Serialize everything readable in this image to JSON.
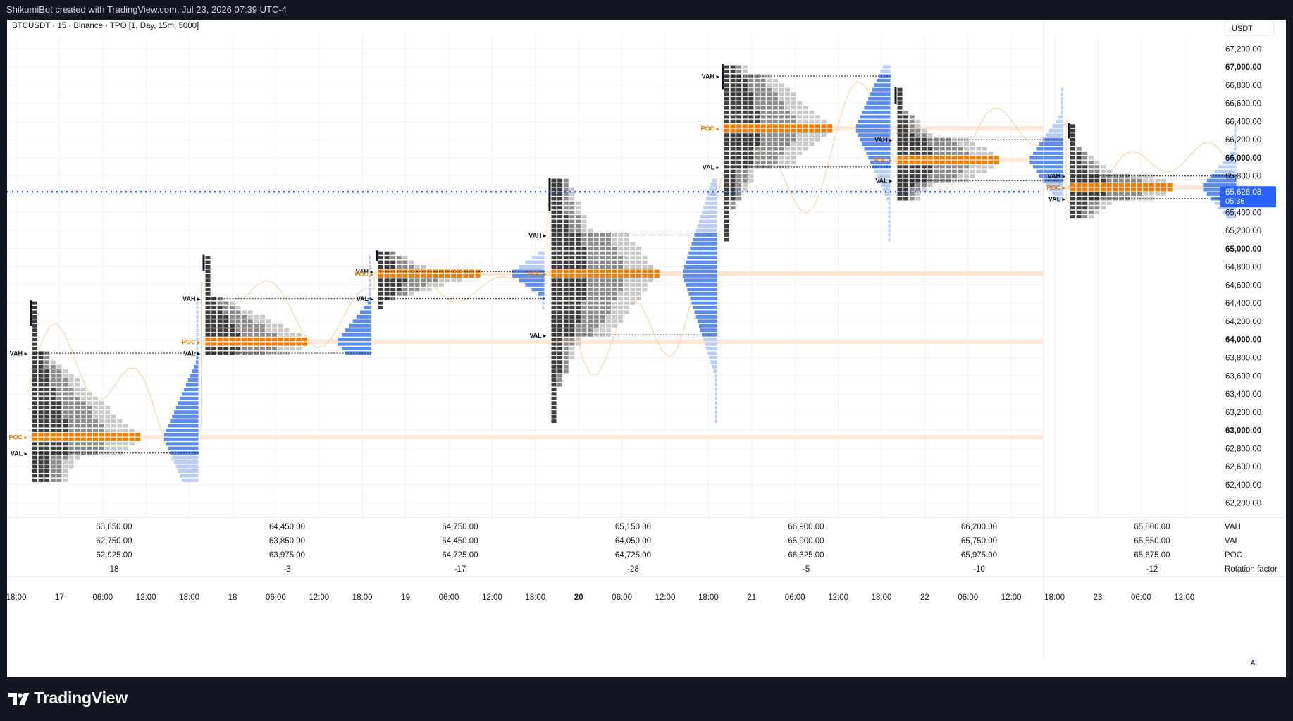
{
  "header": {
    "attribution": "ShikumiBot created with TradingView.com, Jul 23, 2026 07:39 UTC-4"
  },
  "legend": {
    "symbol_line": "BTCUSDT · 15 · Binance · TPO [1, Day, 15m, 5000]"
  },
  "currency_label": "USDT",
  "branding": {
    "logo_text": "TradingView",
    "auto_scale_label": "A"
  },
  "colors": {
    "poc": "#f57c00",
    "poc_band": "#fbe2cc",
    "profile_dark": "#3d3d3d",
    "profile_mid": "#8a8a8a",
    "profile_light": "#c8c8c8",
    "volume_blue": "#5b8def",
    "volume_blue_light": "#b8cdf7",
    "price_line": "#2962ff",
    "price_path": "#ffcc99",
    "grid": "#f0f3fa"
  },
  "chart_data": {
    "type": "tpo_profile",
    "symbol": "BTCUSDT",
    "exchange": "Binance",
    "interval": "15",
    "y_range": [
      62050,
      67350
    ],
    "y_ticks": [
      "67,200.00",
      "67,000.00",
      "66,800.00",
      "66,600.00",
      "66,400.00",
      "66,200.00",
      "66,000.00",
      "65,800.00",
      "65,600.00",
      "65,400.00",
      "65,200.00",
      "65,000.00",
      "64,800.00",
      "64,600.00",
      "64,400.00",
      "64,200.00",
      "64,000.00",
      "63,800.00",
      "63,600.00",
      "63,400.00",
      "63,200.00",
      "63,000.00",
      "62,800.00",
      "62,600.00",
      "62,400.00",
      "62,200.00"
    ],
    "y_ticks_bold": [
      "67,000.00",
      "66,000.00",
      "65,000.00",
      "64,000.00",
      "63,000.00"
    ],
    "x_ticks": [
      {
        "label": "18:00",
        "slot": 0
      },
      {
        "label": "17",
        "slot": 1
      },
      {
        "label": "06:00",
        "slot": 2
      },
      {
        "label": "12:00",
        "slot": 3
      },
      {
        "label": "18:00",
        "slot": 4
      },
      {
        "label": "18",
        "slot": 5
      },
      {
        "label": "06:00",
        "slot": 6
      },
      {
        "label": "12:00",
        "slot": 7
      },
      {
        "label": "18:00",
        "slot": 8
      },
      {
        "label": "19",
        "slot": 9
      },
      {
        "label": "06:00",
        "slot": 10
      },
      {
        "label": "12:00",
        "slot": 11
      },
      {
        "label": "18:00",
        "slot": 12
      },
      {
        "label": "20",
        "slot": 13,
        "bold": true
      },
      {
        "label": "06:00",
        "slot": 14
      },
      {
        "label": "12:00",
        "slot": 15
      },
      {
        "label": "18:00",
        "slot": 16
      },
      {
        "label": "21",
        "slot": 17
      },
      {
        "label": "06:00",
        "slot": 18
      },
      {
        "label": "12:00",
        "slot": 19
      },
      {
        "label": "18:00",
        "slot": 20
      },
      {
        "label": "22",
        "slot": 21
      },
      {
        "label": "06:00",
        "slot": 22
      },
      {
        "label": "12:00",
        "slot": 23
      },
      {
        "label": "18:00",
        "slot": 24
      },
      {
        "label": "23",
        "slot": 25
      },
      {
        "label": "06:00",
        "slot": 26
      },
      {
        "label": "12:00",
        "slot": 27
      }
    ],
    "last_price": {
      "value": 65626.08,
      "label": "65,626.08",
      "countdown": "05:36"
    },
    "sessions": [
      {
        "vah": 63850,
        "val": 62750,
        "poc": 62925,
        "vah_label": "63,850.00",
        "val_label": "62,750.00",
        "poc_label": "62,925.00",
        "rotation": "18",
        "high": 64400,
        "low": 62450
      },
      {
        "vah": 64450,
        "val": 63850,
        "poc": 63975,
        "vah_label": "64,450.00",
        "val_label": "63,850.00",
        "poc_label": "63,975.00",
        "rotation": "-3",
        "high": 64900,
        "low": 63850
      },
      {
        "vah": 64750,
        "val": 64450,
        "poc": 64725,
        "vah_label": "64,750.00",
        "val_label": "64,450.00",
        "poc_label": "64,725.00",
        "rotation": "-17",
        "high": 64950,
        "low": 64350
      },
      {
        "vah": 65150,
        "val": 64050,
        "poc": 64725,
        "vah_label": "65,150.00",
        "val_label": "64,050.00",
        "poc_label": "64,725.00",
        "rotation": "-28",
        "high": 65750,
        "low": 63100
      },
      {
        "vah": 66900,
        "val": 65900,
        "poc": 66325,
        "vah_label": "66,900.00",
        "val_label": "65,900.00",
        "poc_label": "66,325.00",
        "rotation": "-5",
        "high": 67000,
        "low": 65100
      },
      {
        "vah": 66200,
        "val": 65750,
        "poc": 65975,
        "vah_label": "66,200.00",
        "val_label": "65,750.00",
        "poc_label": "65,975.00",
        "rotation": "-10",
        "high": 66750,
        "low": 65550
      },
      {
        "vah": 65800,
        "val": 65550,
        "poc": 65675,
        "vah_label": "65,800.00",
        "val_label": "65,550.00",
        "poc_label": "65,675.00",
        "rotation": "-12",
        "high": 66350,
        "low": 65350
      }
    ],
    "row_labels": {
      "vah": "VAH",
      "val": "VAL",
      "poc": "POC",
      "rotation": "Rotation factor"
    },
    "level_markers": {
      "vah": "VAH",
      "val": "VAL",
      "poc": "POC"
    }
  }
}
